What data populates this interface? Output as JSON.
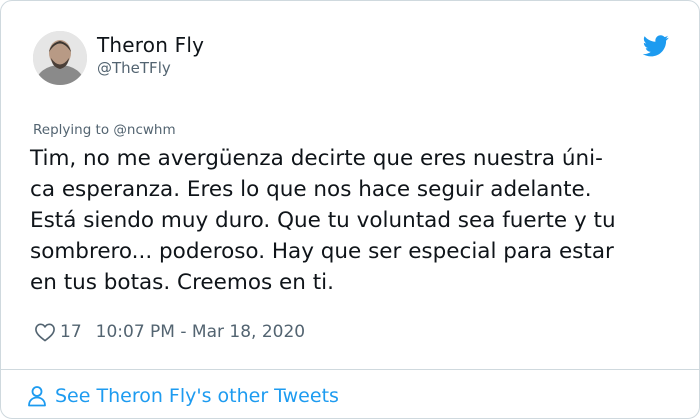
{
  "tweet": {
    "author_name": "Theron Fly",
    "author_handle": "@TheTFly",
    "reply_prefix": "Replying to ",
    "reply_mention": "@ncwhm",
    "body_lines": [
      "Tim, no me avergüenza decirte que eres nuestra úni-",
      "ca esperanza. Eres lo que nos hace seguir adelante.",
      "Está siendo muy duro. Que tu voluntad sea fuerte y tu",
      "sombrero... poderoso. Hay que ser especial para estar",
      "en tus botas. Creemos en ti."
    ],
    "like_count": "17",
    "timestamp": "10:07 PM - Mar 18, 2020",
    "see_more_label": "See Theron Fly's other Tweets"
  },
  "icons": {
    "brand": "twitter-bird-icon",
    "like": "heart-icon",
    "profile": "person-icon"
  },
  "colors": {
    "brand_blue": "#1d9bf0",
    "secondary_text": "#536471",
    "border": "#cfd9de"
  }
}
